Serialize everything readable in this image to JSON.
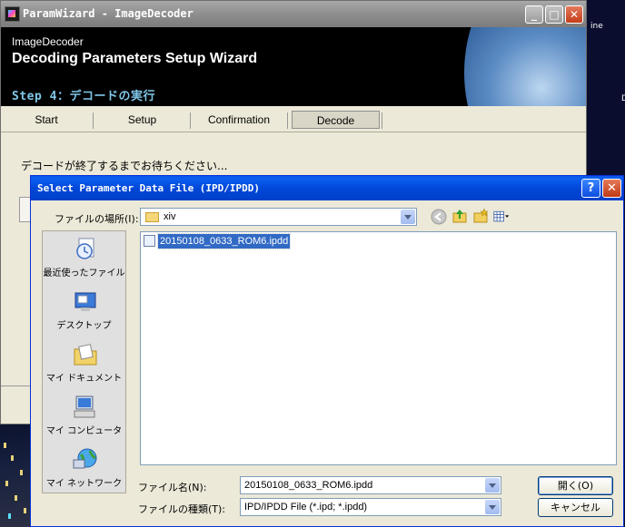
{
  "desktop": {
    "text1": "ine",
    "text2": "D"
  },
  "main_window": {
    "title": "ParamWizard - ImageDecoder",
    "app_name": "ImageDecoder",
    "heading": "Decoding Parameters Setup Wizard",
    "step": "Step 4：デコードの実行",
    "tabs": [
      {
        "label": "Start"
      },
      {
        "label": "Setup"
      },
      {
        "label": "Confirmation"
      },
      {
        "label": "Decode",
        "active": true
      }
    ],
    "message": "デコードが終了するまでお待ちください..."
  },
  "dialog": {
    "title": "Select Parameter Data File (IPD/IPDD)",
    "look_in_label": "ファイルの場所(I):",
    "look_in_value": "xiv",
    "places": [
      {
        "label": "最近使ったファイル",
        "icon": "recent-documents-icon"
      },
      {
        "label": "デスクトップ",
        "icon": "desktop-icon"
      },
      {
        "label": "マイ ドキュメント",
        "icon": "my-documents-icon"
      },
      {
        "label": "マイ コンピュータ",
        "icon": "my-computer-icon"
      },
      {
        "label": "マイ ネットワーク",
        "icon": "my-network-icon"
      }
    ],
    "files": [
      {
        "name": "20150108_0633_ROM6.ipdd",
        "selected": true
      }
    ],
    "filename_label": "ファイル名(N):",
    "filename_value": "20150108_0633_ROM6.ipdd",
    "filetype_label": "ファイルの種類(T):",
    "filetype_value": "IPD/IPDD File (*.ipd; *.ipdd)",
    "open_label": "開く(O)",
    "cancel_label": "キャンセル"
  }
}
